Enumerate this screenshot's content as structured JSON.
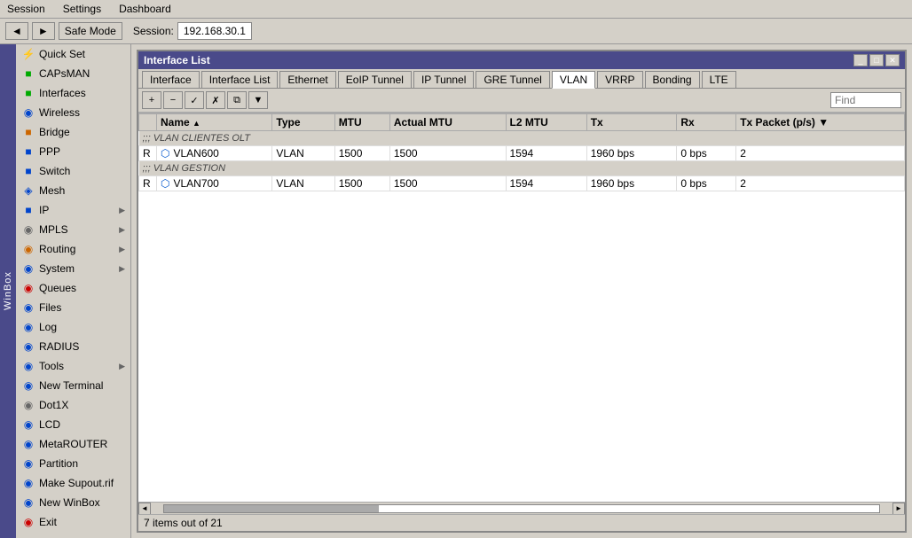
{
  "menubar": {
    "items": [
      "Session",
      "Settings",
      "Dashboard"
    ]
  },
  "toolbar": {
    "back_label": "◄",
    "forward_label": "►",
    "safe_mode_label": "Safe Mode",
    "session_label": "Session:",
    "session_value": "192.168.30.1"
  },
  "sidebar": {
    "items": [
      {
        "id": "quick-set",
        "label": "Quick Set",
        "icon": "⚡",
        "color": "green",
        "has_arrow": false
      },
      {
        "id": "capsman",
        "label": "CAPsMAN",
        "icon": "■",
        "color": "green",
        "has_arrow": false
      },
      {
        "id": "interfaces",
        "label": "Interfaces",
        "icon": "■",
        "color": "green",
        "has_arrow": false
      },
      {
        "id": "wireless",
        "label": "Wireless",
        "icon": "◉",
        "color": "blue",
        "has_arrow": false
      },
      {
        "id": "bridge",
        "label": "Bridge",
        "icon": "■",
        "color": "orange",
        "has_arrow": false
      },
      {
        "id": "ppp",
        "label": "PPP",
        "icon": "■",
        "color": "blue",
        "has_arrow": false
      },
      {
        "id": "switch",
        "label": "Switch",
        "icon": "■",
        "color": "blue",
        "has_arrow": false
      },
      {
        "id": "mesh",
        "label": "Mesh",
        "icon": "◈",
        "color": "blue",
        "has_arrow": false
      },
      {
        "id": "ip",
        "label": "IP",
        "icon": "■",
        "color": "blue",
        "has_arrow": true
      },
      {
        "id": "mpls",
        "label": "MPLS",
        "icon": "◉",
        "color": "gray",
        "has_arrow": true
      },
      {
        "id": "routing",
        "label": "Routing",
        "icon": "◉",
        "color": "orange",
        "has_arrow": true
      },
      {
        "id": "system",
        "label": "System",
        "icon": "◉",
        "color": "blue",
        "has_arrow": true
      },
      {
        "id": "queues",
        "label": "Queues",
        "icon": "◉",
        "color": "red",
        "has_arrow": false
      },
      {
        "id": "files",
        "label": "Files",
        "icon": "◉",
        "color": "blue",
        "has_arrow": false
      },
      {
        "id": "log",
        "label": "Log",
        "icon": "◉",
        "color": "blue",
        "has_arrow": false
      },
      {
        "id": "radius",
        "label": "RADIUS",
        "icon": "◉",
        "color": "blue",
        "has_arrow": false
      },
      {
        "id": "tools",
        "label": "Tools",
        "icon": "◉",
        "color": "blue",
        "has_arrow": true
      },
      {
        "id": "new-terminal",
        "label": "New Terminal",
        "icon": "◉",
        "color": "blue",
        "has_arrow": false
      },
      {
        "id": "dot1x",
        "label": "Dot1X",
        "icon": "◉",
        "color": "gray",
        "has_arrow": false
      },
      {
        "id": "lcd",
        "label": "LCD",
        "icon": "◉",
        "color": "blue",
        "has_arrow": false
      },
      {
        "id": "metarouter",
        "label": "MetaROUTER",
        "icon": "◉",
        "color": "blue",
        "has_arrow": false
      },
      {
        "id": "partition",
        "label": "Partition",
        "icon": "◉",
        "color": "blue",
        "has_arrow": false
      },
      {
        "id": "make-supout",
        "label": "Make Supout.rif",
        "icon": "◉",
        "color": "blue",
        "has_arrow": false
      },
      {
        "id": "new-winbox",
        "label": "New WinBox",
        "icon": "◉",
        "color": "blue",
        "has_arrow": false
      },
      {
        "id": "exit",
        "label": "Exit",
        "icon": "◉",
        "color": "red",
        "has_arrow": false
      }
    ]
  },
  "window": {
    "title": "Interface List",
    "tabs": [
      {
        "id": "interface",
        "label": "Interface"
      },
      {
        "id": "interface-list",
        "label": "Interface List"
      },
      {
        "id": "ethernet",
        "label": "Ethernet"
      },
      {
        "id": "eoip-tunnel",
        "label": "EoIP Tunnel"
      },
      {
        "id": "ip-tunnel",
        "label": "IP Tunnel"
      },
      {
        "id": "gre-tunnel",
        "label": "GRE Tunnel"
      },
      {
        "id": "vlan",
        "label": "VLAN",
        "active": true
      },
      {
        "id": "vrrp",
        "label": "VRRP"
      },
      {
        "id": "bonding",
        "label": "Bonding"
      },
      {
        "id": "lte",
        "label": "LTE"
      }
    ],
    "toolbar": {
      "add": "+",
      "remove": "−",
      "enable": "✓",
      "disable": "✗",
      "copy": "⧉",
      "filter": "▼",
      "find_placeholder": "Find"
    },
    "table": {
      "columns": [
        "",
        "Name",
        "Type",
        "MTU",
        "Actual MTU",
        "L2 MTU",
        "Tx",
        "Rx",
        "Tx Packet (p/s)"
      ],
      "sections": [
        {
          "header": ";;; VLAN CLIENTES OLT",
          "rows": [
            {
              "flag": "R",
              "icon": "vlan",
              "name": "VLAN600",
              "type": "VLAN",
              "mtu": "1500",
              "actual_mtu": "1500",
              "l2_mtu": "1594",
              "tx": "1960 bps",
              "rx": "0 bps",
              "tx_packet": "2"
            }
          ]
        },
        {
          "header": ";;; VLAN GESTION",
          "rows": [
            {
              "flag": "R",
              "icon": "vlan",
              "name": "VLAN700",
              "type": "VLAN",
              "mtu": "1500",
              "actual_mtu": "1500",
              "l2_mtu": "1594",
              "tx": "1960 bps",
              "rx": "0 bps",
              "tx_packet": "2"
            }
          ]
        }
      ]
    },
    "statusbar": "7 items out of 21"
  },
  "winbox_label": "WinBox"
}
